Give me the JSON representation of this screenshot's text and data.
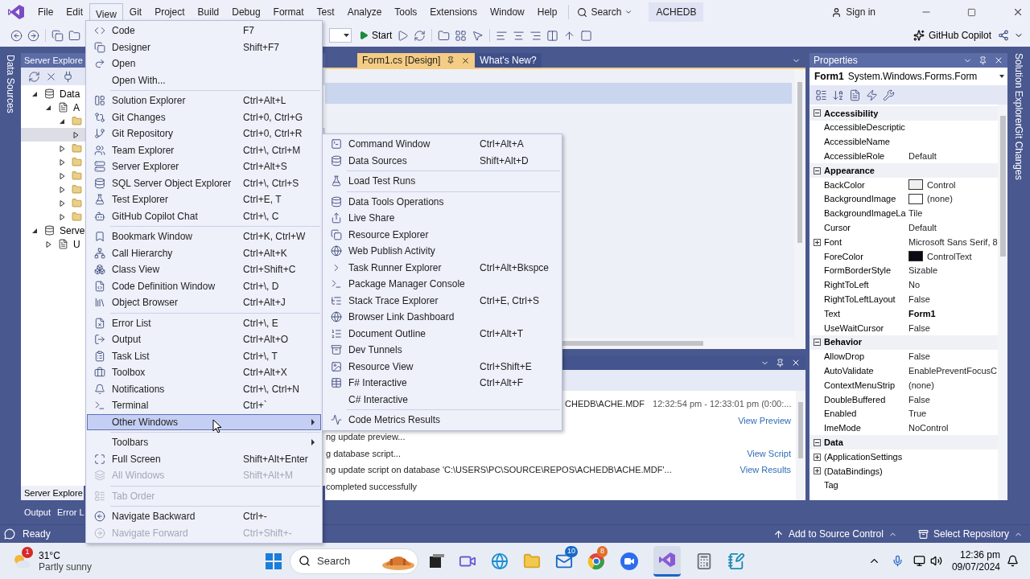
{
  "menu_bar": {
    "items": [
      {
        "label": "File",
        "selected": false
      },
      {
        "label": "Edit",
        "selected": false
      },
      {
        "label": "View",
        "selected": true
      },
      {
        "label": "Git",
        "selected": false
      },
      {
        "label": "Project",
        "selected": false
      },
      {
        "label": "Build",
        "selected": false
      },
      {
        "label": "Debug",
        "selected": false
      },
      {
        "label": "Format",
        "selected": false
      },
      {
        "label": "Test",
        "selected": false
      },
      {
        "label": "Analyze",
        "selected": false
      },
      {
        "label": "Tools",
        "selected": false
      },
      {
        "label": "Extensions",
        "selected": false
      },
      {
        "label": "Window",
        "selected": false
      },
      {
        "label": "Help",
        "selected": false
      }
    ],
    "search": "Search",
    "solution": "ACHEDB",
    "sign_in": "Sign in"
  },
  "toolbar": {
    "start": "Start",
    "copilot": "GitHub Copilot"
  },
  "left_strip": [
    "Data Sources"
  ],
  "server_explorer": {
    "title": "Server Explore",
    "tree": [
      {
        "label": "Data",
        "expanded": true,
        "selected": false,
        "children": [
          {
            "label": "A",
            "expanded": true,
            "selected": false,
            "children": [
              {
                "expanded": true,
                "selected": false,
                "children": [
                  {
                    "expanded": false,
                    "selected": true
                  }
                ]
              },
              {
                "expanded": false,
                "selected": false
              },
              {
                "expanded": false,
                "selected": false
              },
              {
                "expanded": false,
                "selected": false
              },
              {
                "expanded": false,
                "selected": false
              },
              {
                "expanded": false,
                "selected": false
              },
              {
                "expanded": false,
                "selected": false
              }
            ]
          }
        ]
      },
      {
        "label": "Serve",
        "expanded": true,
        "selected": false,
        "children": [
          {
            "label": "U",
            "expanded": false,
            "selected": false
          }
        ]
      }
    ],
    "bottom_tab": "Server Explore"
  },
  "bottom_tabs": [
    "Output",
    "Error L"
  ],
  "editor_tabs": [
    {
      "label": "Form1.cs [Design]",
      "selected": true
    },
    {
      "label": "What's New?",
      "selected": false
    }
  ],
  "output": {
    "rows": [
      {
        "kind": "summary",
        "text": "CHEDB\\ACHE.MDF",
        "detail": "12:32:54 pm - 12:33:01 pm (0:00:..."
      },
      {
        "kind": "step",
        "link": "View Preview"
      },
      {
        "kind": "step",
        "text": "ng update preview..."
      },
      {
        "kind": "step",
        "text": "g database script...",
        "link": "View Script"
      },
      {
        "kind": "step",
        "text": "ng update script on database 'C:\\USERS\\PC\\SOURCE\\REPOS\\ACHEDB\\ACHE.MDF'...",
        "link": "View Results"
      },
      {
        "kind": "step",
        "text": "completed successfully"
      }
    ]
  },
  "properties": {
    "title": "Properties",
    "object": "Form1",
    "type": "System.Windows.Forms.Form",
    "rows": [
      {
        "kind": "category",
        "name": "Accessibility",
        "expanded": true
      },
      {
        "kind": "property",
        "name": "AccessibleDescriptic"
      },
      {
        "kind": "property",
        "name": "AccessibleName"
      },
      {
        "kind": "property",
        "name": "AccessibleRole",
        "value": "Default",
        "modified": false
      },
      {
        "kind": "category",
        "name": "Appearance",
        "expanded": true
      },
      {
        "kind": "property",
        "name": "BackColor",
        "value": "Control",
        "color": "#f0f0f0",
        "modified": false
      },
      {
        "kind": "property",
        "name": "BackgroundImage",
        "value": "(none)",
        "color": "#ffffff",
        "modified": false
      },
      {
        "kind": "property",
        "name": "BackgroundImageLa",
        "value": "Tile",
        "modified": false
      },
      {
        "kind": "property",
        "name": "Cursor",
        "value": "Default",
        "modified": false
      },
      {
        "kind": "expandable",
        "name": "Font",
        "value": "Microsoft Sans Serif, 8",
        "expanded": false,
        "modified": false
      },
      {
        "kind": "property",
        "name": "ForeColor",
        "value": "ControlText",
        "color": "#0a0a14",
        "modified": false
      },
      {
        "kind": "property",
        "name": "FormBorderStyle",
        "value": "Sizable",
        "modified": false
      },
      {
        "kind": "property",
        "name": "RightToLeft",
        "value": "No",
        "modified": false
      },
      {
        "kind": "property",
        "name": "RightToLeftLayout",
        "value": "False",
        "modified": false
      },
      {
        "kind": "property",
        "name": "Text",
        "value": "Form1",
        "modified": true
      },
      {
        "kind": "property",
        "name": "UseWaitCursor",
        "value": "False",
        "modified": false
      },
      {
        "kind": "category",
        "name": "Behavior",
        "expanded": true
      },
      {
        "kind": "property",
        "name": "AllowDrop",
        "value": "False",
        "modified": false
      },
      {
        "kind": "property",
        "name": "AutoValidate",
        "value": "EnablePreventFocusC",
        "modified": false
      },
      {
        "kind": "property",
        "name": "ContextMenuStrip",
        "value": "(none)",
        "modified": false
      },
      {
        "kind": "property",
        "name": "DoubleBuffered",
        "value": "False",
        "modified": false
      },
      {
        "kind": "property",
        "name": "Enabled",
        "value": "True",
        "modified": false
      },
      {
        "kind": "property",
        "name": "ImeMode",
        "value": "NoControl",
        "modified": false
      },
      {
        "kind": "category",
        "name": "Data",
        "expanded": true
      },
      {
        "kind": "expandable",
        "name": "(ApplicationSettings",
        "expanded": false
      },
      {
        "kind": "expandable",
        "name": "(DataBindings)",
        "expanded": false
      },
      {
        "kind": "property",
        "name": "Tag"
      }
    ]
  },
  "right_strip": [
    "Solution Explorer",
    "Git Changes"
  ],
  "status_bar": {
    "text": "Ready",
    "items": [
      "Add to Source Control",
      "Select Repository"
    ]
  },
  "view_menu": {
    "groups": [
      [
        {
          "label": "Code",
          "shortcut": "F7",
          "disabled": false,
          "selected": false
        },
        {
          "label": "Designer",
          "shortcut": "Shift+F7",
          "disabled": false,
          "selected": false
        },
        {
          "label": "Open",
          "disabled": false,
          "selected": false
        },
        {
          "label": "Open With...",
          "disabled": false,
          "selected": false
        }
      ],
      [
        {
          "label": "Solution Explorer",
          "shortcut": "Ctrl+Alt+L",
          "disabled": false,
          "selected": false
        },
        {
          "label": "Git Changes",
          "shortcut": "Ctrl+0, Ctrl+G",
          "disabled": false,
          "selected": false
        },
        {
          "label": "Git Repository",
          "shortcut": "Ctrl+0, Ctrl+R",
          "disabled": false,
          "selected": false
        },
        {
          "label": "Team Explorer",
          "shortcut": "Ctrl+\\, Ctrl+M",
          "disabled": false,
          "selected": false
        },
        {
          "label": "Server Explorer",
          "shortcut": "Ctrl+Alt+S",
          "disabled": false,
          "selected": false
        },
        {
          "label": "SQL Server Object Explorer",
          "shortcut": "Ctrl+\\, Ctrl+S",
          "disabled": false,
          "selected": false
        },
        {
          "label": "Test Explorer",
          "shortcut": "Ctrl+E, T",
          "disabled": false,
          "selected": false
        },
        {
          "label": "GitHub Copilot Chat",
          "shortcut": "Ctrl+\\, C",
          "disabled": false,
          "selected": false
        }
      ],
      [
        {
          "label": "Bookmark Window",
          "shortcut": "Ctrl+K, Ctrl+W",
          "disabled": false,
          "selected": false
        },
        {
          "label": "Call Hierarchy",
          "shortcut": "Ctrl+Alt+K",
          "disabled": false,
          "selected": false
        },
        {
          "label": "Class View",
          "shortcut": "Ctrl+Shift+C",
          "disabled": false,
          "selected": false
        },
        {
          "label": "Code Definition Window",
          "shortcut": "Ctrl+\\, D",
          "disabled": false,
          "selected": false
        },
        {
          "label": "Object Browser",
          "shortcut": "Ctrl+Alt+J",
          "disabled": false,
          "selected": false
        }
      ],
      [
        {
          "label": "Error List",
          "shortcut": "Ctrl+\\, E",
          "disabled": false,
          "selected": false
        },
        {
          "label": "Output",
          "shortcut": "Ctrl+Alt+O",
          "disabled": false,
          "selected": false
        },
        {
          "label": "Task List",
          "shortcut": "Ctrl+\\, T",
          "disabled": false,
          "selected": false
        },
        {
          "label": "Toolbox",
          "shortcut": "Ctrl+Alt+X",
          "disabled": false,
          "selected": false
        },
        {
          "label": "Notifications",
          "shortcut": "Ctrl+\\, Ctrl+N",
          "disabled": false,
          "selected": false
        },
        {
          "label": "Terminal",
          "shortcut": "Ctrl+`",
          "disabled": false,
          "selected": false
        },
        {
          "label": "Other Windows",
          "submenu": true,
          "disabled": false,
          "selected": true
        }
      ],
      [
        {
          "label": "Toolbars",
          "submenu": true,
          "disabled": false,
          "selected": false
        },
        {
          "label": "Full Screen",
          "shortcut": "Shift+Alt+Enter",
          "disabled": false,
          "selected": false
        },
        {
          "label": "All Windows",
          "shortcut": "Shift+Alt+M",
          "disabled": true,
          "selected": false
        }
      ],
      [
        {
          "label": "Tab Order",
          "disabled": true,
          "selected": false
        }
      ],
      [
        {
          "label": "Navigate Backward",
          "shortcut": "Ctrl+-",
          "disabled": false,
          "selected": false
        },
        {
          "label": "Navigate Forward",
          "shortcut": "Ctrl+Shift+-",
          "disabled": true,
          "selected": false
        }
      ]
    ]
  },
  "other_windows_menu": {
    "groups": [
      [
        {
          "label": "Command Window",
          "shortcut": "Ctrl+Alt+A",
          "disabled": false,
          "selected": false
        },
        {
          "label": "Data Sources",
          "shortcut": "Shift+Alt+D",
          "disabled": false,
          "selected": false
        }
      ],
      [
        {
          "label": "Load Test Runs",
          "disabled": false,
          "selected": false
        }
      ],
      [
        {
          "label": "Data Tools Operations",
          "disabled": false,
          "selected": false
        },
        {
          "label": "Live Share",
          "disabled": false,
          "selected": false
        },
        {
          "label": "Resource Explorer",
          "disabled": false,
          "selected": false
        },
        {
          "label": "Web Publish Activity",
          "disabled": false,
          "selected": false
        },
        {
          "label": "Task Runner Explorer",
          "shortcut": "Ctrl+Alt+Bkspce",
          "disabled": false,
          "selected": false
        },
        {
          "label": "Package Manager Console",
          "disabled": false,
          "selected": false
        },
        {
          "label": "Stack Trace Explorer",
          "shortcut": "Ctrl+E, Ctrl+S",
          "disabled": false,
          "selected": false
        },
        {
          "label": "Browser Link Dashboard",
          "disabled": false,
          "selected": false
        },
        {
          "label": "Document Outline",
          "shortcut": "Ctrl+Alt+T",
          "disabled": false,
          "selected": false
        },
        {
          "label": "Dev Tunnels",
          "disabled": false,
          "selected": false
        },
        {
          "label": "Resource View",
          "shortcut": "Ctrl+Shift+E",
          "disabled": false,
          "selected": false
        },
        {
          "label": "F# Interactive",
          "shortcut": "Ctrl+Alt+F",
          "disabled": false,
          "selected": false
        },
        {
          "label": "C# Interactive",
          "disabled": false,
          "selected": false
        }
      ],
      [
        {
          "label": "Code Metrics Results",
          "disabled": false,
          "selected": false
        }
      ]
    ]
  },
  "taskbar": {
    "weather": {
      "temp": "31°C",
      "condition": "Partly sunny",
      "badge": "1"
    },
    "search": "Search",
    "mail_badge": "10",
    "browser_badge": "8",
    "time": "12:36 pm",
    "date": "09/07/2024"
  }
}
